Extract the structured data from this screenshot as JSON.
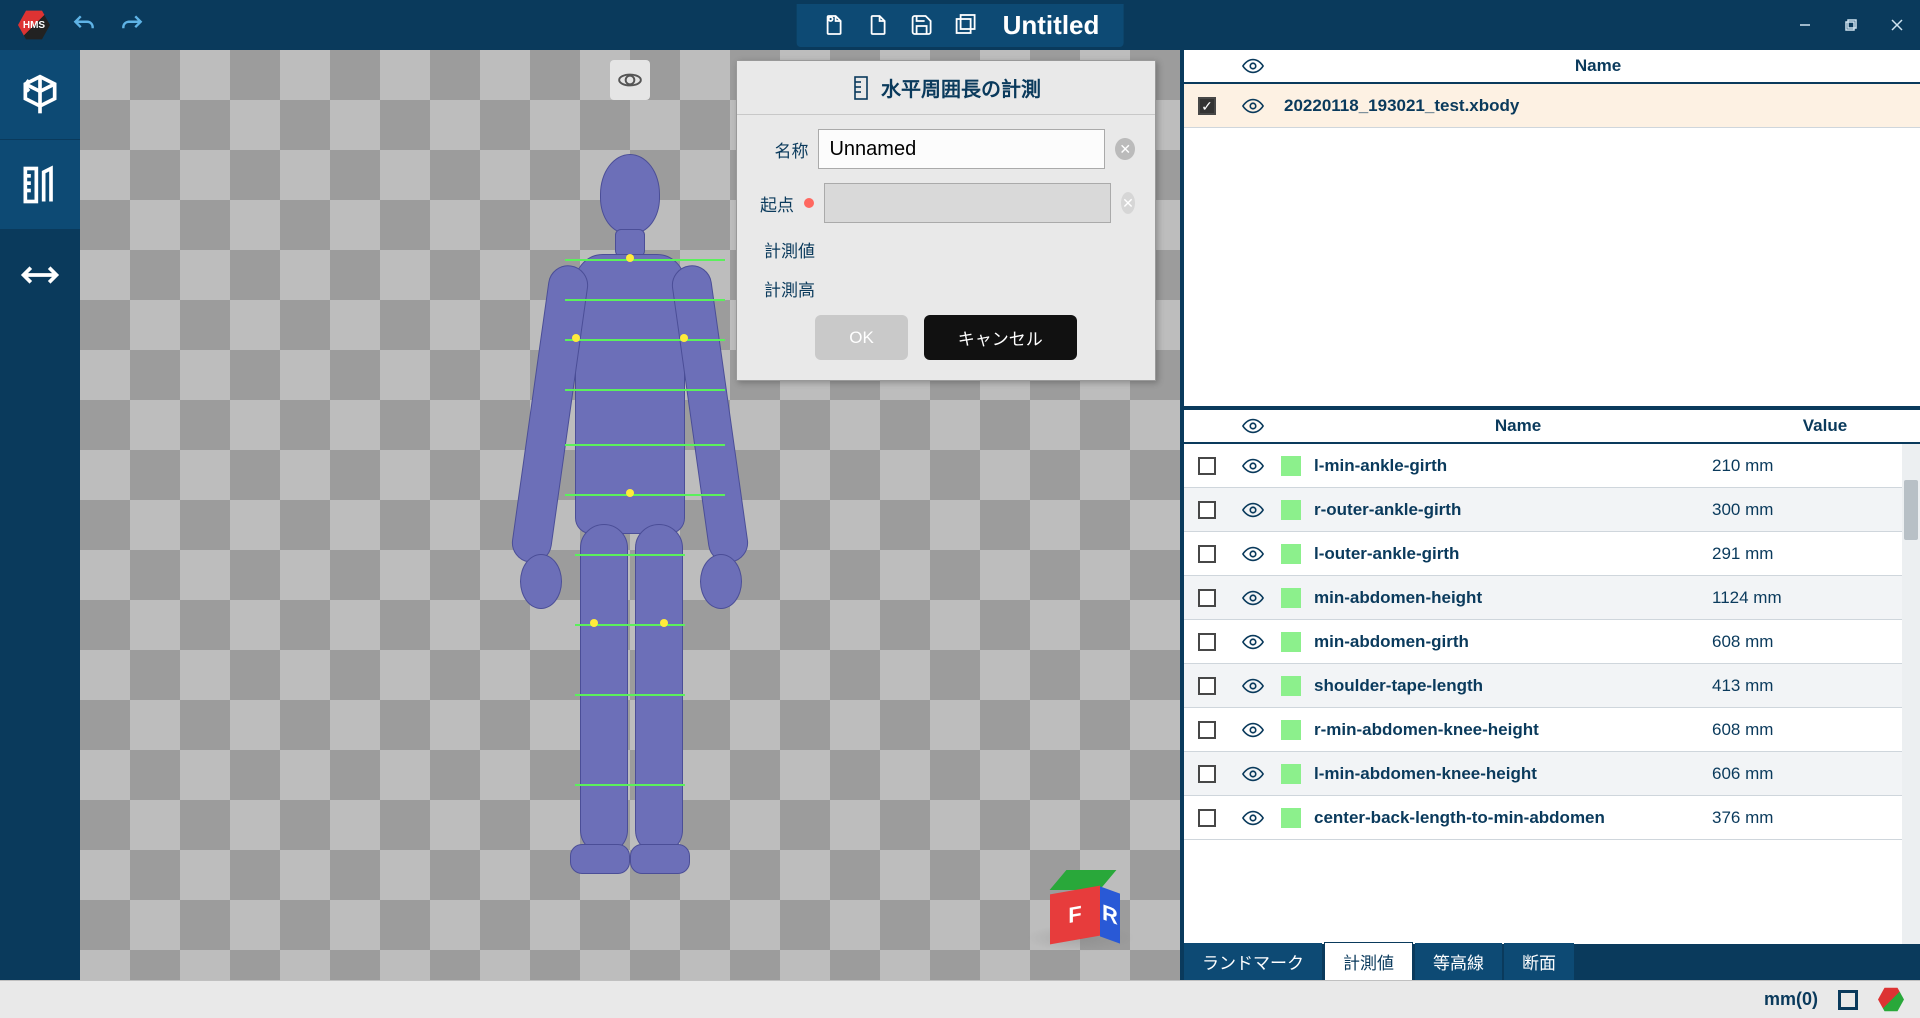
{
  "titlebar": {
    "doc_title": "Untitled"
  },
  "dialog": {
    "title": "水平周囲長の計測",
    "labels": {
      "name": "名称",
      "origin": "起点",
      "measure_value": "計測値",
      "measure_height": "計測高"
    },
    "name_value": "Unnamed",
    "origin_value": "",
    "buttons": {
      "ok": "OK",
      "cancel": "キャンセル"
    }
  },
  "files_panel": {
    "header_name": "Name",
    "rows": [
      {
        "checked": true,
        "name": "20220118_193021_test.xbody"
      }
    ]
  },
  "measure_panel": {
    "header_name": "Name",
    "header_value": "Value",
    "rows": [
      {
        "name": "l-min-ankle-girth",
        "value": "210 mm"
      },
      {
        "name": "r-outer-ankle-girth",
        "value": "300 mm"
      },
      {
        "name": "l-outer-ankle-girth",
        "value": "291 mm"
      },
      {
        "name": "min-abdomen-height",
        "value": "1124 mm"
      },
      {
        "name": "min-abdomen-girth",
        "value": "608 mm"
      },
      {
        "name": "shoulder-tape-length",
        "value": "413 mm"
      },
      {
        "name": "r-min-abdomen-knee-height",
        "value": "608 mm"
      },
      {
        "name": "l-min-abdomen-knee-height",
        "value": "606 mm"
      },
      {
        "name": "center-back-length-to-min-abdomen",
        "value": "376 mm"
      }
    ],
    "tabs": {
      "landmark": "ランドマーク",
      "measure": "計測値",
      "contour": "等高線",
      "section": "断面"
    }
  },
  "statusbar": {
    "unit": "mm(0)"
  }
}
